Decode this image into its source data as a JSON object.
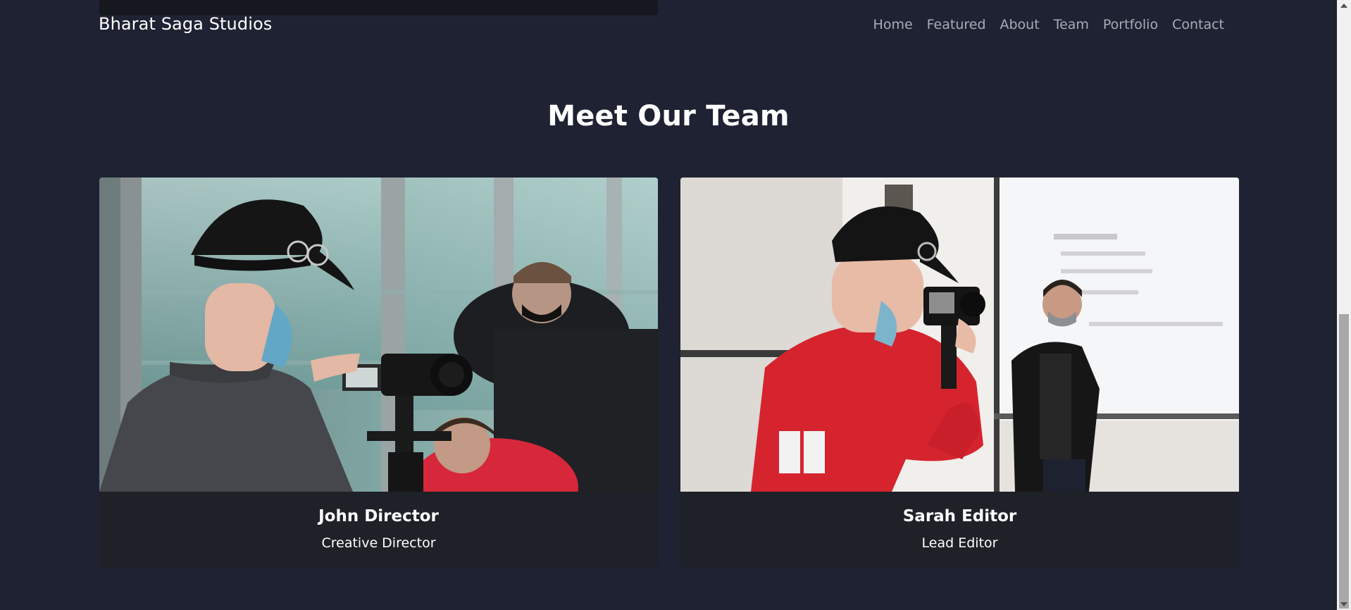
{
  "brand": "Bharat Saga Studios",
  "nav": {
    "links": [
      "Home",
      "Featured",
      "About",
      "Team",
      "Portfolio",
      "Contact"
    ]
  },
  "team": {
    "title": "Meet Our Team",
    "members": [
      {
        "name": "John Director",
        "role": "Creative Director",
        "photo": "camera-operator-photo"
      },
      {
        "name": "Sarah Editor",
        "role": "Lead Editor",
        "photo": "red-hoodie-camera-operator-photo"
      }
    ]
  },
  "colors": {
    "background": "#1e2232",
    "card": "#1f2128",
    "nav_link": "#a8adb6",
    "text": "#ffffff"
  }
}
